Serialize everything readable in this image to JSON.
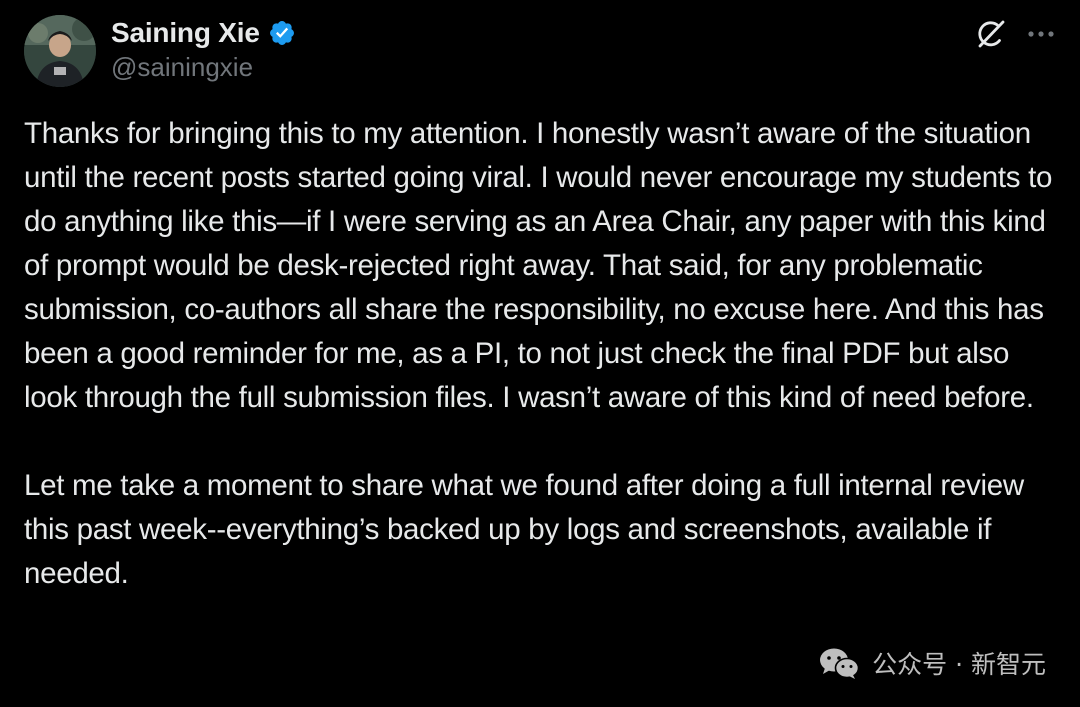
{
  "author": {
    "display_name": "Saining Xie",
    "handle": "@sainingxie",
    "verified": true,
    "verified_color": "#1d9bf0"
  },
  "icons": {
    "verified": "verified-badge-icon",
    "grok": "grok-icon",
    "more": "more-options-icon",
    "watermark_logo": "wechat-logo-icon"
  },
  "tweet": {
    "paragraphs": [
      "Thanks for bringing this to my attention. I honestly wasn’t aware of the situation until the recent posts started going viral. I would never encourage my students to do anything like this—if I were serving as an Area Chair, any paper with this kind of prompt would be desk-rejected right away. That said, for any problematic submission, co-authors all share the responsibility, no excuse here. And this has been a good reminder for me, as a PI, to not just check the final PDF but also look through the full submission files. I wasn’t aware of this kind of need before.",
      "Let me take a moment to share what we found after doing a full internal review this past week--everything’s backed up by logs and screenshots, available if needed."
    ]
  },
  "watermark": {
    "text": "公众号 · 新智元"
  },
  "colors": {
    "background": "#000000",
    "text_primary": "#e7e9ea",
    "text_secondary": "#71767b"
  }
}
